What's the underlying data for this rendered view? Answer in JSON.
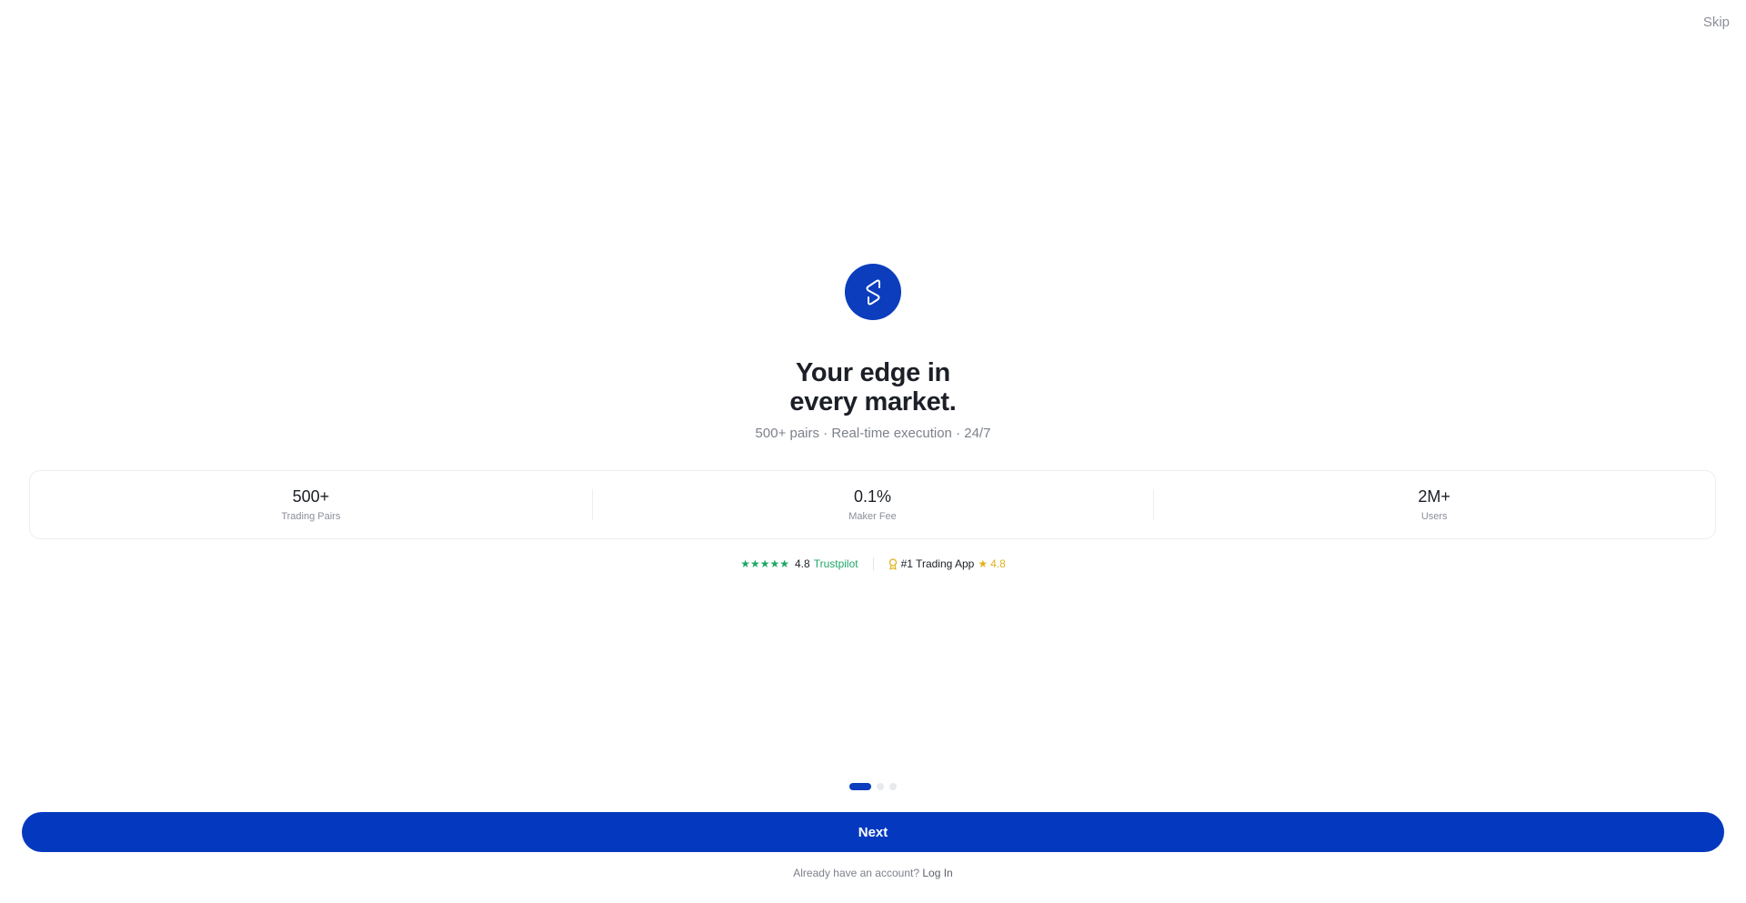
{
  "header": {
    "skip_label": "Skip"
  },
  "hero": {
    "logo_icon": "brand-s-logo-icon",
    "headline_line1": "Your edge in",
    "headline_line2": "every market.",
    "subline": "500+ pairs · Real-time execution · 24/7"
  },
  "stats": [
    {
      "value": "500+",
      "label": "Trading Pairs"
    },
    {
      "value": "0.1%",
      "label": "Maker Fee"
    },
    {
      "value": "2M+",
      "label": "Users"
    }
  ],
  "ratings": {
    "trustpilot_stars": "★★★★★",
    "trustpilot_score": "4.8",
    "trustpilot_label": "Trustpilot",
    "award_icon": "award-ribbon-icon",
    "award_label": "#1 Trading App",
    "app_star": "★",
    "app_score": "4.8"
  },
  "pagination": {
    "total": 3,
    "active": 1
  },
  "footer": {
    "next_label": "Next",
    "login_prompt": "Already have an account?",
    "login_link": "Log In"
  },
  "colors": {
    "brand": "#0439bf",
    "trustpilot_green": "#1fa865",
    "gold": "#e0b21b"
  }
}
